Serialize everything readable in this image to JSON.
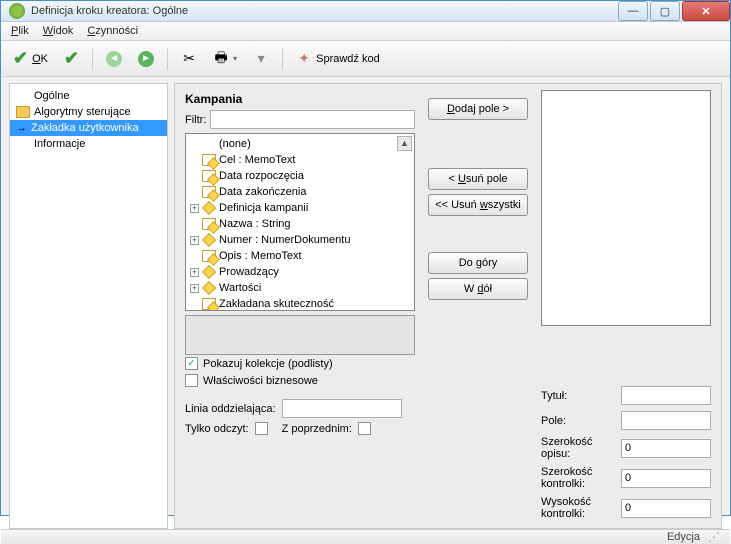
{
  "window": {
    "title": "Definicja kroku kreatora: Ogólne"
  },
  "menu": {
    "file": "Plik",
    "view": "Widok",
    "actions": "Czynności"
  },
  "toolbar": {
    "ok": "OK",
    "check_code": "Sprawdź kod"
  },
  "sidebar": {
    "items": [
      {
        "label": "Ogólne"
      },
      {
        "label": "Algorytmy sterujące"
      },
      {
        "label": "Zakładka użytkownika"
      },
      {
        "label": "Informacje"
      }
    ]
  },
  "main": {
    "section_title": "Kampania",
    "filter_label": "Filtr:",
    "tree": [
      {
        "label": "(none)",
        "expander": "",
        "icon": "none"
      },
      {
        "label": "Cel : MemoText",
        "expander": "",
        "icon": "card"
      },
      {
        "label": "Data rozpoczęcia",
        "expander": "",
        "icon": "card"
      },
      {
        "label": "Data zakończenia",
        "expander": "",
        "icon": "card"
      },
      {
        "label": "Definicja kampanii",
        "expander": "+",
        "icon": "diamond"
      },
      {
        "label": "Nazwa : String",
        "expander": "",
        "icon": "card"
      },
      {
        "label": "Numer : NumerDokumentu",
        "expander": "+",
        "icon": "diamond"
      },
      {
        "label": "Opis : MemoText",
        "expander": "",
        "icon": "card"
      },
      {
        "label": "Prowadzący",
        "expander": "+",
        "icon": "diamond"
      },
      {
        "label": "Wartości",
        "expander": "+",
        "icon": "diamond"
      },
      {
        "label": "Zakładana skuteczność",
        "expander": "",
        "icon": "card"
      }
    ],
    "buttons": {
      "add": "Dodaj pole >",
      "remove": "< Usuń pole",
      "remove_all": "<< Usuń wszystki",
      "move_up": "Do góry",
      "move_down": "W dół"
    },
    "checkboxes": {
      "show_collections": "Pokazuj kolekcje (podlisty)",
      "business_props": "Właściwości biznesowe"
    },
    "bottom": {
      "divider_label": "Linia oddzielająca:",
      "readonly_label": "Tylko odczyt:",
      "from_prev_label": "Z poprzednim:"
    },
    "props": {
      "title_label": "Tytuł:",
      "field_label": "Pole:",
      "desc_width_label": "Szerokość opisu:",
      "ctrl_width_label": "Szerokość kontrolki:",
      "ctrl_height_label": "Wysokość kontrolki:",
      "desc_width": "0",
      "ctrl_width": "0",
      "ctrl_height": "0"
    }
  },
  "status": {
    "mode": "Edycja"
  }
}
